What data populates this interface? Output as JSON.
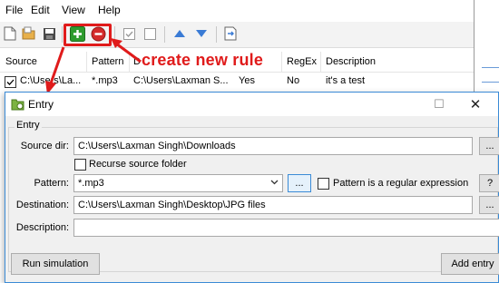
{
  "menu": {
    "file": "File",
    "edit": "Edit",
    "view": "View",
    "help": "Help"
  },
  "toolbar": {
    "icons": [
      "new-file-icon",
      "open-folder-icon",
      "save-icon",
      "add-rule-icon",
      "delete-rule-icon",
      "check-icon",
      "uncheck-icon",
      "move-up-icon",
      "move-down-icon",
      "export-icon"
    ]
  },
  "grid": {
    "headers": [
      "Source",
      "Pattern",
      "D",
      "RegEx",
      "Description"
    ],
    "row": {
      "source": "C:\\Users\\La...",
      "pattern": "*.mp3",
      "destination": "C:\\Users\\Laxman S...",
      "recurse": "Yes",
      "regex": "No",
      "description": "it's a test"
    }
  },
  "annotation": {
    "text": "create new rule"
  },
  "dialog": {
    "title": "Entry",
    "group_label": "Entry",
    "source_dir_label": "Source dir:",
    "source_dir_value": "C:\\Users\\Laxman Singh\\Downloads",
    "browse_label": "...",
    "recurse_label": "Recurse source folder",
    "pattern_label": "Pattern:",
    "pattern_value": "*.mp3",
    "regex_label": "Pattern is a regular expression",
    "help_label": "?",
    "destination_label": "Destination:",
    "destination_value": "C:\\Users\\Laxman Singh\\Desktop\\JPG files",
    "description_label": "Description:",
    "description_value": "",
    "run_simulation_label": "Run simulation",
    "add_entry_label": "Add entry",
    "close_glyph": "✕",
    "maximize_glyph": "☐",
    "minimize_glyph": "—"
  },
  "colors": {
    "accent": "#e01b1b",
    "dialog_border": "#3b8bd6",
    "add_green": "#2e9b2e",
    "delete_red": "#d42a2a",
    "arrow_blue": "#3a7bd5"
  }
}
